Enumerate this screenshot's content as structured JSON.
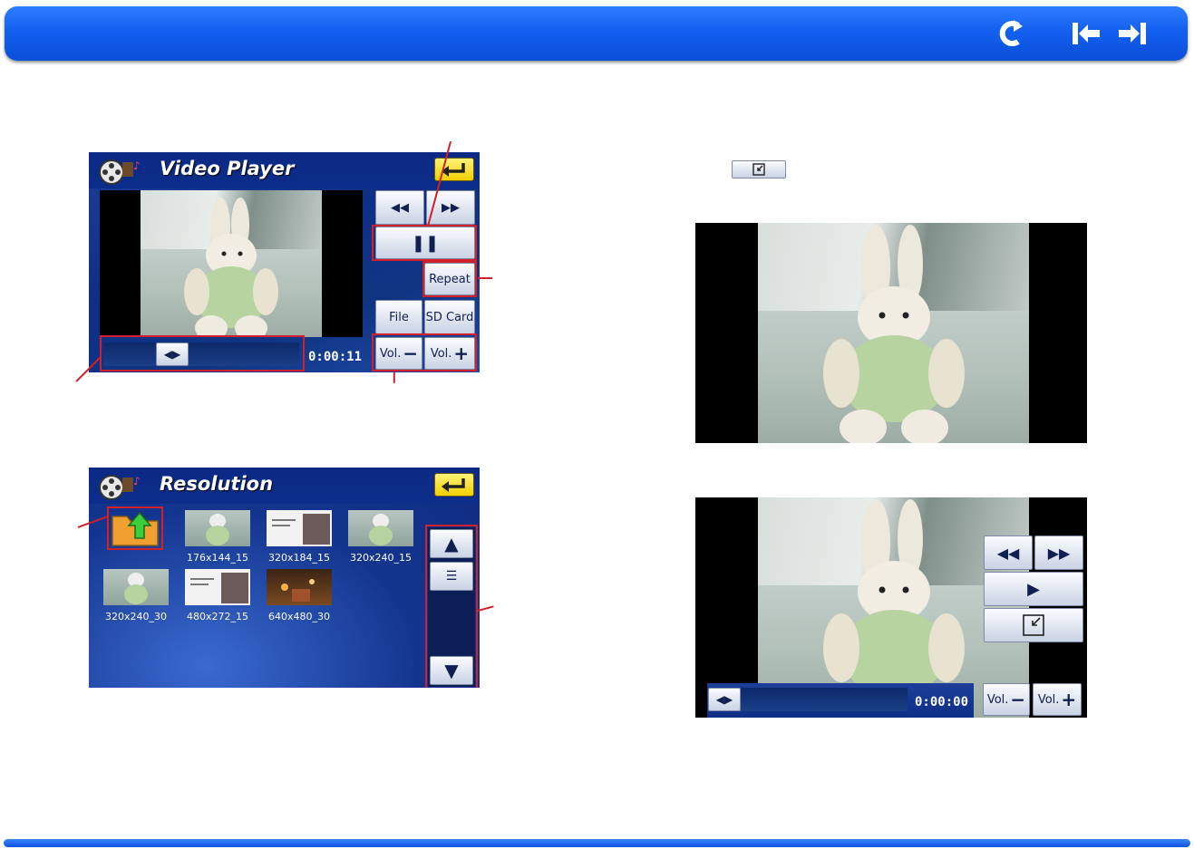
{
  "colors": {
    "accent": "#1360f0",
    "callout": "#d1202a",
    "screen_bg": "#0f2f86",
    "back_button": "#f2cf00"
  },
  "topbar": {
    "icons": [
      "refresh-icon",
      "arrow-left-icon",
      "arrow-right-icon"
    ]
  },
  "video_player": {
    "title": "Video Player",
    "buttons": {
      "rewind": "◀◀",
      "forward": "▶▶",
      "pause": "❚❚",
      "repeat": "Repeat",
      "file": "File",
      "sd_card": "SD Card",
      "vol_down": "Vol.",
      "vol_up": "Vol."
    },
    "time": "0:00:11",
    "seek_position": 0.32
  },
  "resolution": {
    "title": "Resolution",
    "files": [
      "176x144_15",
      "320x184_15",
      "320x240_15",
      "320x240_30",
      "480x272_15",
      "640x480_30"
    ]
  },
  "fullscreen_player": {
    "buttons": {
      "rewind": "◀◀",
      "forward": "▶▶",
      "play": "▶",
      "vol_down": "Vol.",
      "vol_up": "Vol."
    },
    "time": "0:00:00",
    "seek_position": 0.0
  }
}
